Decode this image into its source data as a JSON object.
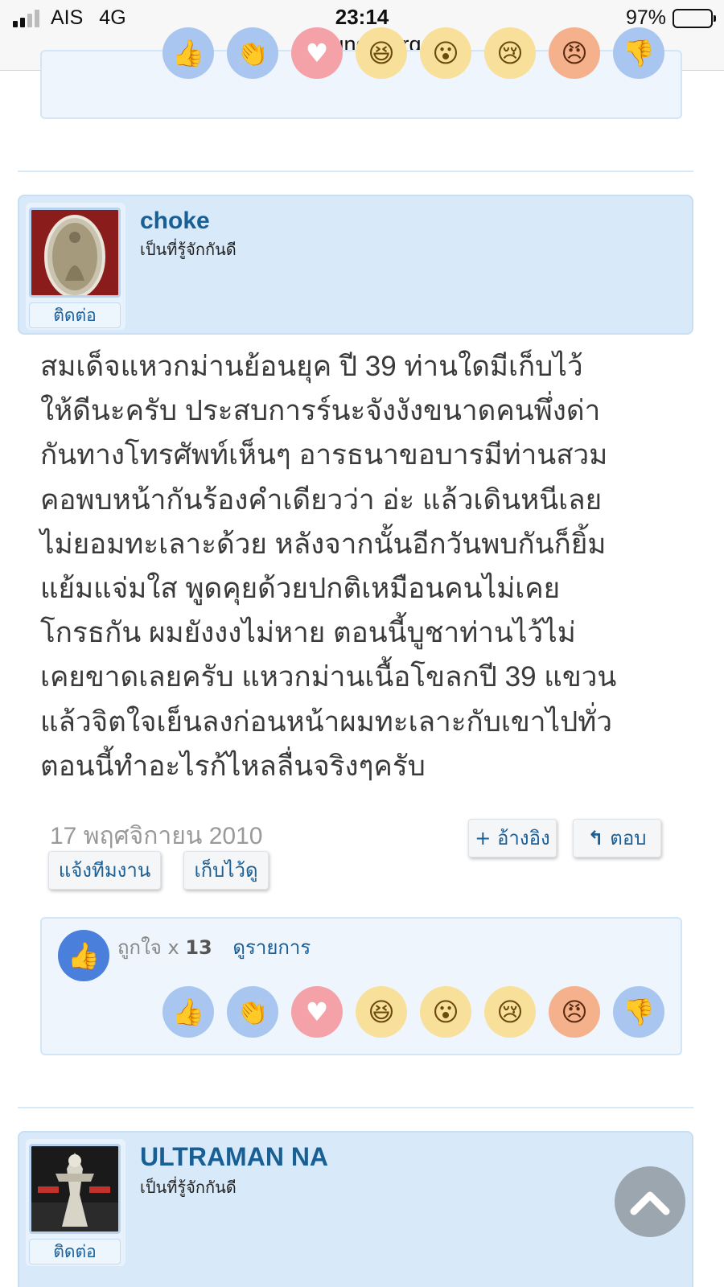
{
  "status_bar": {
    "carrier": "AIS",
    "network": "4G",
    "time": "23:14",
    "url": "palungjit.org",
    "battery": "97%",
    "battery_level": 0.97
  },
  "reactions": [
    {
      "name": "like-icon",
      "glyph": "👍"
    },
    {
      "name": "clap-icon",
      "glyph": "👏"
    },
    {
      "name": "love-icon",
      "glyph": "♥"
    },
    {
      "name": "haha-icon",
      "glyph": "😆"
    },
    {
      "name": "wow-icon",
      "glyph": "😮"
    },
    {
      "name": "sad-icon",
      "glyph": "😢"
    },
    {
      "name": "angry-icon",
      "glyph": "😠"
    },
    {
      "name": "dislike-icon",
      "glyph": "👎"
    }
  ],
  "post1": {
    "username": "choke",
    "user_title": "เป็นที่รู้จักกันดี",
    "contact": "ติดต่อ",
    "body_lines": [
      "สมเด็จแหวกม่านย้อนยุค ปี 39 ท่านใดมีเก็บไว้",
      "ให้ดีนะครับ ประสบการร์นะจังงังขนาดคนพึ่งด่า",
      "กันทางโทรศัพท์เห็นๆ อารธนาขอบารมีท่านสวม",
      "คอพบหน้ากันร้องคำเดียวว่า อ่ะ แล้วเดินหนีเลย",
      "ไม่ยอมทะเลาะด้วย หลังจากนั้นอีกวันพบกันก็ยิ้ม",
      "แย้มแจ่มใส พูดคุยด้วยปกติเหมือนคนไม่เคย",
      "โกรธกัน ผมยังงงไม่หาย ตอนนี้บูชาท่านไว้ไม่",
      "เคยขาดเลยครับ แหวกม่านเนื้อโขลกปี 39 แขวน",
      "แล้วจิตใจเย็นลงก่อนหน้าผมทะเลาะกับเขาไปทั่ว",
      "ตอนนี้ทำอะไรก้ไหลลื่นจริงๆครับ"
    ],
    "date": "17 พฤศจิกายน 2010",
    "quote_label": "+ อ้างอิง",
    "reply_label": "ตอบ",
    "report_label": "แจ้งทีมงาน",
    "save_label": "เก็บไว้ดู",
    "like_text": "ถูกใจ x",
    "like_count": "13",
    "like_list_label": "ดูรายการ"
  },
  "post2": {
    "username": "ULTRAMAN NA",
    "user_title": "เป็นที่รู้จักกันดี",
    "contact": "ติดต่อ"
  },
  "colors": {
    "link": "#175f95",
    "header_bg": "#d8e9f9",
    "reaction_box_bg": "#eef5fd",
    "like_blue": "#4a7fdc"
  }
}
